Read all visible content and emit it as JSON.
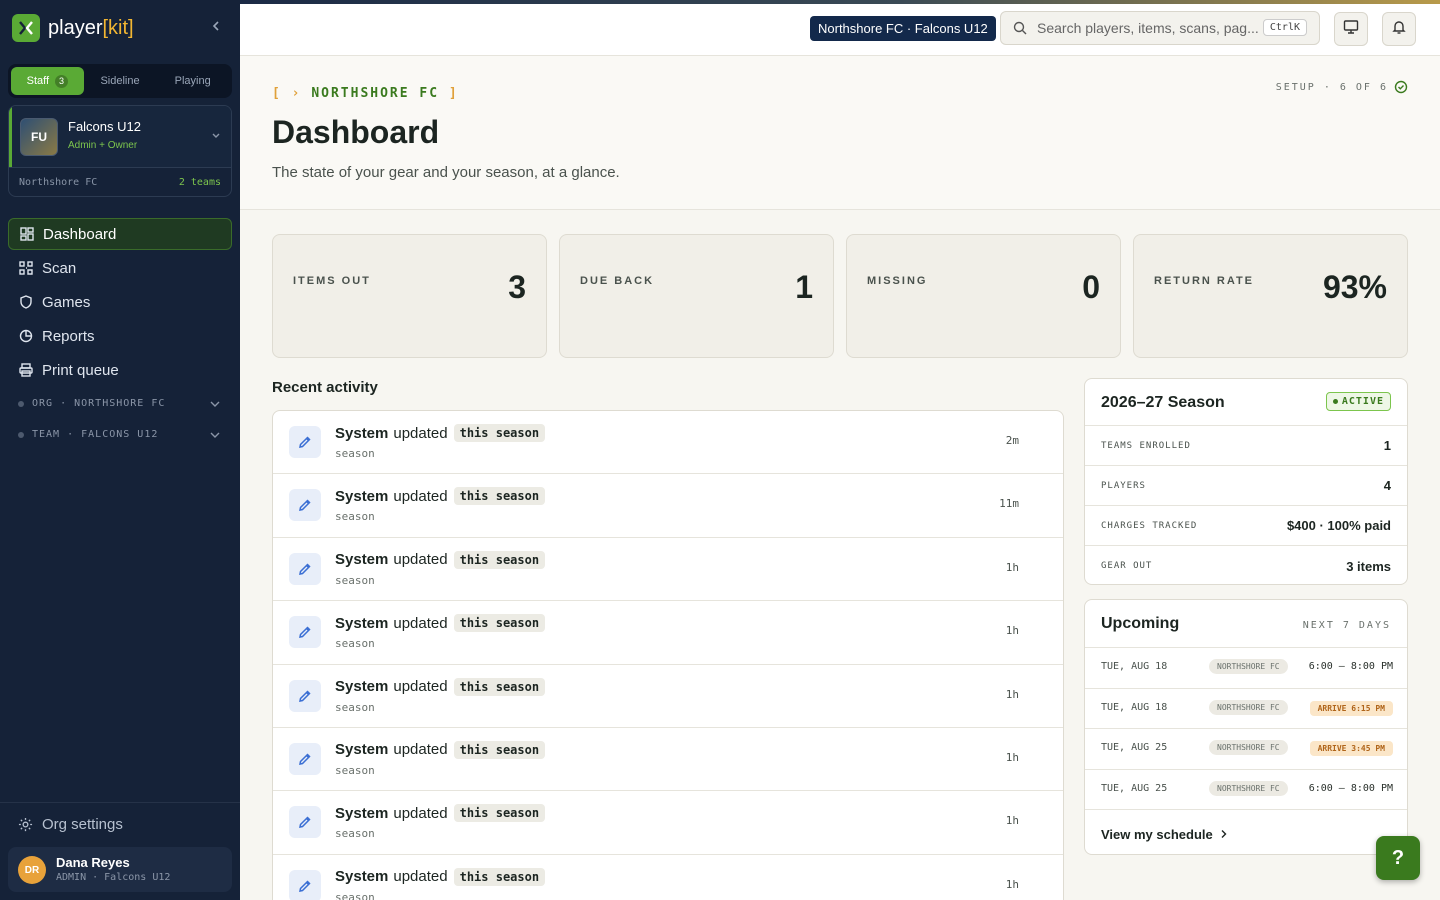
{
  "brand": {
    "name_main": "player",
    "name_bracket_open": "[",
    "name_kit": "kit",
    "name_bracket_close": "]"
  },
  "sidebar": {
    "modes": [
      {
        "label": "Staff",
        "badge": "3",
        "active": true
      },
      {
        "label": "Sideline"
      },
      {
        "label": "Playing"
      }
    ],
    "team": {
      "initials": "FU",
      "name": "Falcons U12",
      "role": "Admin + Owner",
      "org": "Northshore FC",
      "team_count": "2 teams"
    },
    "nav": [
      {
        "label": "Dashboard",
        "icon": "grid-icon",
        "active": true
      },
      {
        "label": "Scan",
        "icon": "qr-icon"
      },
      {
        "label": "Games",
        "icon": "shield-icon"
      },
      {
        "label": "Reports",
        "icon": "chart-icon"
      },
      {
        "label": "Print queue",
        "icon": "printer-icon"
      }
    ],
    "groups": [
      {
        "label": "ORG · NORTHSHORE FC"
      },
      {
        "label": "TEAM · FALCONS U12"
      }
    ],
    "org_settings": "Org settings",
    "user": {
      "initials": "DR",
      "name": "Dana Reyes",
      "role": "ADMIN · Falcons U12"
    }
  },
  "topbar": {
    "context": "Northshore FC · Falcons U12",
    "search_placeholder": "Search players, items, scans, pag...",
    "shortcut": "CtrlK"
  },
  "header": {
    "breadcrumb_open": "[",
    "breadcrumb_arrow": "›",
    "breadcrumb": "NORTHSHORE FC",
    "breadcrumb_close": "]",
    "title": "Dashboard",
    "subtitle": "The state of your gear and your season, at a glance.",
    "setup": "SETUP · 6 OF 6"
  },
  "stats": [
    {
      "label": "ITEMS OUT",
      "value": "3"
    },
    {
      "label": "DUE BACK",
      "value": "1"
    },
    {
      "label": "MISSING",
      "value": "0"
    },
    {
      "label": "RETURN RATE",
      "value": "93%"
    }
  ],
  "activity": {
    "title": "Recent activity",
    "rows": [
      {
        "actor": "System",
        "verb": "updated",
        "target": "this season",
        "sub": "season",
        "time": "2m"
      },
      {
        "actor": "System",
        "verb": "updated",
        "target": "this season",
        "sub": "season",
        "time": "11m"
      },
      {
        "actor": "System",
        "verb": "updated",
        "target": "this season",
        "sub": "season",
        "time": "1h"
      },
      {
        "actor": "System",
        "verb": "updated",
        "target": "this season",
        "sub": "season",
        "time": "1h"
      },
      {
        "actor": "System",
        "verb": "updated",
        "target": "this season",
        "sub": "season",
        "time": "1h"
      },
      {
        "actor": "System",
        "verb": "updated",
        "target": "this season",
        "sub": "season",
        "time": "1h"
      },
      {
        "actor": "System",
        "verb": "updated",
        "target": "this season",
        "sub": "season",
        "time": "1h"
      },
      {
        "actor": "System",
        "verb": "updated",
        "target": "this season",
        "sub": "season",
        "time": "1h"
      }
    ]
  },
  "season": {
    "title": "2026–27 Season",
    "status": "ACTIVE",
    "rows": [
      {
        "label": "TEAMS ENROLLED",
        "value": "1"
      },
      {
        "label": "PLAYERS",
        "value": "4"
      },
      {
        "label": "CHARGES TRACKED",
        "value": "$400 · 100% paid"
      },
      {
        "label": "GEAR OUT",
        "value": "3 items"
      }
    ]
  },
  "upcoming": {
    "title": "Upcoming",
    "range": "NEXT 7 DAYS",
    "events": [
      {
        "date": "TUE, AUG 18",
        "org": "NORTHSHORE FC",
        "time": "6:00 – 8:00 PM",
        "arrive": ""
      },
      {
        "date": "TUE, AUG 18",
        "org": "NORTHSHORE FC",
        "time": "",
        "arrive": "ARRIVE 6:15 PM"
      },
      {
        "date": "TUE, AUG 25",
        "org": "NORTHSHORE FC",
        "time": "",
        "arrive": "ARRIVE 3:45 PM"
      },
      {
        "date": "TUE, AUG 25",
        "org": "NORTHSHORE FC",
        "time": "6:00 – 8:00 PM",
        "arrive": ""
      }
    ],
    "link": "View my schedule"
  },
  "help": "?",
  "colors": {
    "brand_green": "#5aaa35",
    "sidebar_bg": "#152238",
    "accent_gold": "#f2b632",
    "context_pill": "#13294b"
  }
}
